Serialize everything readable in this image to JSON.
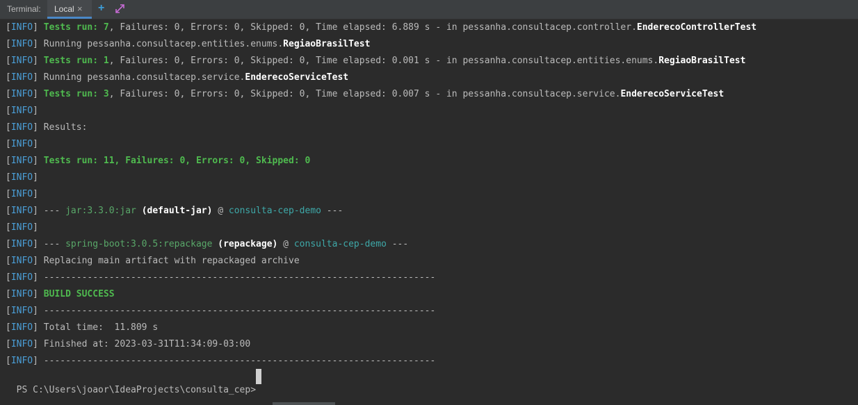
{
  "tabbar": {
    "label": "Terminal:",
    "tab_name": "Local",
    "close_glyph": "×",
    "add_glyph": "+",
    "expand_icon": "expand-icon"
  },
  "info_tag": "INFO",
  "lines": [
    {
      "runs": [
        {
          "t": "Tests run: 7",
          "s": "g"
        },
        {
          "t": ", Failures: 0, Errors: 0, Skipped: 0, Time elapsed: 6.889 s - in pessanha.consultacep.controller.",
          "s": "n"
        },
        {
          "t": "EnderecoControllerTest",
          "s": "w"
        }
      ]
    },
    {
      "runs": [
        {
          "t": "Running pessanha.consultacep.entities.enums.",
          "s": "n"
        },
        {
          "t": "RegiaoBrasilTest",
          "s": "w"
        }
      ]
    },
    {
      "runs": [
        {
          "t": "Tests run: 1",
          "s": "g"
        },
        {
          "t": ", Failures: 0, Errors: 0, Skipped: 0, Time elapsed: 0.001 s - in pessanha.consultacep.entities.enums.",
          "s": "n"
        },
        {
          "t": "RegiaoBrasilTest",
          "s": "w"
        }
      ]
    },
    {
      "runs": [
        {
          "t": "Running pessanha.consultacep.service.",
          "s": "n"
        },
        {
          "t": "EnderecoServiceTest",
          "s": "w"
        }
      ]
    },
    {
      "runs": [
        {
          "t": "Tests run: 3",
          "s": "g"
        },
        {
          "t": ", Failures: 0, Errors: 0, Skipped: 0, Time elapsed: 0.007 s - in pessanha.consultacep.service.",
          "s": "n"
        },
        {
          "t": "EnderecoServiceTest",
          "s": "w"
        }
      ]
    },
    {
      "runs": []
    },
    {
      "runs": [
        {
          "t": "Results:",
          "s": "n"
        }
      ]
    },
    {
      "runs": []
    },
    {
      "runs": [
        {
          "t": "Tests run: 11, Failures: 0, Errors: 0, Skipped: 0",
          "s": "g"
        }
      ]
    },
    {
      "runs": []
    },
    {
      "runs": []
    },
    {
      "runs": [
        {
          "t": "--- ",
          "s": "n"
        },
        {
          "t": "jar:3.3.0:jar",
          "s": "gn"
        },
        {
          "t": " ",
          "s": "n"
        },
        {
          "t": "(default-jar)",
          "s": "w"
        },
        {
          "t": " @ ",
          "s": "n"
        },
        {
          "t": "consulta-cep-demo",
          "s": "tl"
        },
        {
          "t": " ---",
          "s": "n"
        }
      ]
    },
    {
      "runs": []
    },
    {
      "runs": [
        {
          "t": "--- ",
          "s": "n"
        },
        {
          "t": "spring-boot:3.0.5:repackage",
          "s": "gn"
        },
        {
          "t": " ",
          "s": "n"
        },
        {
          "t": "(repackage)",
          "s": "w"
        },
        {
          "t": " @ ",
          "s": "n"
        },
        {
          "t": "consulta-cep-demo",
          "s": "tl"
        },
        {
          "t": " ---",
          "s": "n"
        }
      ]
    },
    {
      "runs": [
        {
          "t": "Replacing main artifact with repackaged archive",
          "s": "n"
        }
      ]
    },
    {
      "runs": [
        {
          "t": "------------------------------------------------------------------------",
          "s": "n"
        }
      ]
    },
    {
      "runs": [
        {
          "t": "BUILD SUCCESS",
          "s": "g"
        }
      ]
    },
    {
      "runs": [
        {
          "t": "------------------------------------------------------------------------",
          "s": "n"
        }
      ]
    },
    {
      "runs": [
        {
          "t": "Total time:  11.809 s",
          "s": "n"
        }
      ]
    },
    {
      "runs": [
        {
          "t": "Finished at: 2023-03-31T11:34:09-03:00",
          "s": "n"
        }
      ]
    },
    {
      "runs": [
        {
          "t": "------------------------------------------------------------------------",
          "s": "n"
        }
      ]
    }
  ],
  "prompt": "PS C:\\Users\\joaor\\IdeaProjects\\consulta_cep>"
}
